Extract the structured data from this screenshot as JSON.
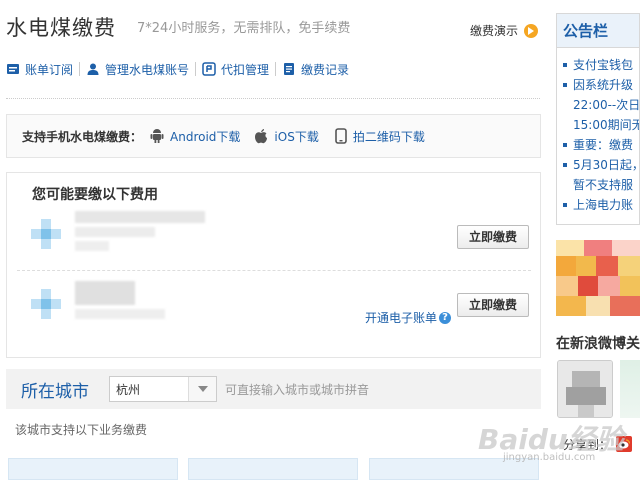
{
  "header": {
    "title": "水电煤缴费",
    "subtitle": "7*24小时服务，无需排队，免手续费",
    "demo_label": "缴费演示"
  },
  "nav": {
    "items": [
      {
        "label": "账单订阅",
        "icon": "bill-icon"
      },
      {
        "label": "管理水电煤账号",
        "icon": "user-icon"
      },
      {
        "label": "代扣管理",
        "icon": "autopay-icon"
      },
      {
        "label": "缴费记录",
        "icon": "record-icon"
      }
    ]
  },
  "support": {
    "label": "支持手机水电煤缴费：",
    "android": "Android下载",
    "ios": "iOS下载",
    "qrcode": "拍二维码下载"
  },
  "fees": {
    "title": "您可能要缴以下费用",
    "pay_label": "立即缴费",
    "ebill_label": "开通电子账单"
  },
  "city": {
    "label": "所在城市",
    "value": "杭州",
    "hint": "可直接输入城市或城市拼音",
    "note": "该城市支持以下业务缴费"
  },
  "announce": {
    "title": "公告栏",
    "lines": [
      {
        "text": "支付宝钱包",
        "bullet": true
      },
      {
        "text": "因系统升级",
        "bullet": true
      },
      {
        "text": "22:00--次日",
        "bullet": false
      },
      {
        "text": "15:00期间无",
        "bullet": false
      },
      {
        "text": "重要：缴费",
        "bullet": true
      },
      {
        "text": "5月30日起，",
        "bullet": true
      },
      {
        "text": "暂不支持服",
        "bullet": false
      },
      {
        "text": "上海电力账",
        "bullet": true
      }
    ]
  },
  "weibo": {
    "title": "在新浪微博关",
    "share_label": "分享到："
  },
  "watermark": {
    "brand": "Baidu经验",
    "url": "jingyan.baidu.com"
  },
  "colors": {
    "link": "#1d5fa8",
    "accent": "#f5a623",
    "panel_bg": "#eaf2fa"
  }
}
